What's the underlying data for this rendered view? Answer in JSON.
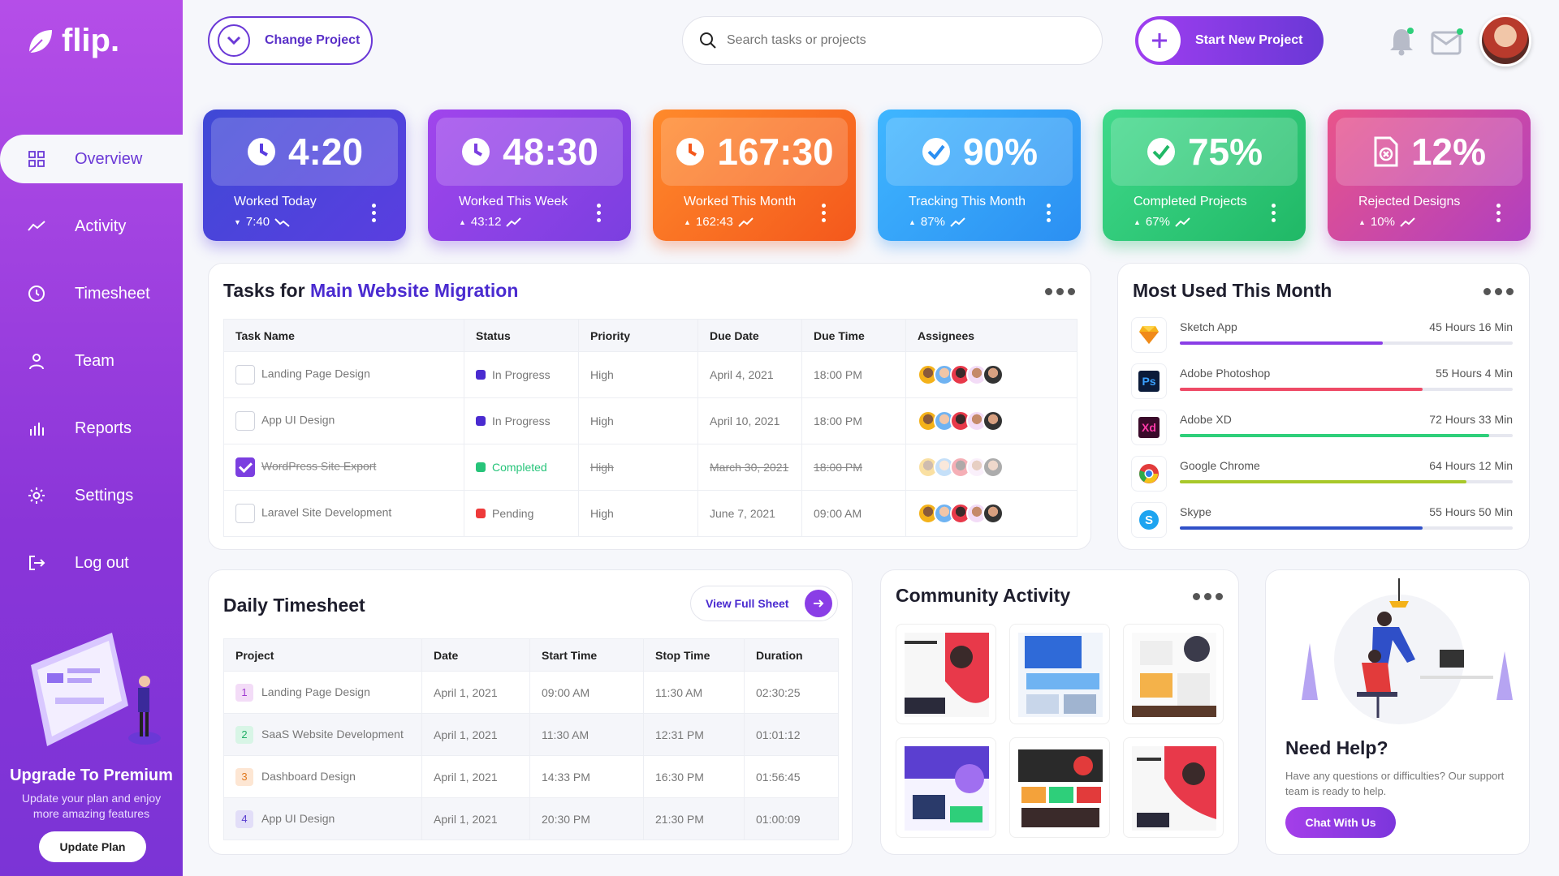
{
  "app": {
    "logo_text": "flip."
  },
  "sidebar": {
    "items": [
      {
        "label": "Overview",
        "icon": "grid-icon"
      },
      {
        "label": "Activity",
        "icon": "trend-icon"
      },
      {
        "label": "Timesheet",
        "icon": "clock-icon"
      },
      {
        "label": "Team",
        "icon": "user-icon"
      },
      {
        "label": "Reports",
        "icon": "bar-chart-icon"
      },
      {
        "label": "Settings",
        "icon": "gear-icon"
      },
      {
        "label": "Log out",
        "icon": "logout-icon"
      }
    ],
    "premium_title": "Upgrade To Premium",
    "premium_text": "Update your plan and enjoy more amazing features",
    "update_button": "Update Plan"
  },
  "header": {
    "change_project": "Change Project",
    "search_placeholder": "Search tasks or projects",
    "start_button": "Start New Project"
  },
  "stats": [
    {
      "value": "4:20",
      "label": "Worked Today",
      "sub": "7:40",
      "trend": "down",
      "color_from": "#3f49d6",
      "color_to": "#5a3ee0",
      "icon": "clock-icon"
    },
    {
      "value": "48:30",
      "label": "Worked This Week",
      "sub": "43:12",
      "trend": "up",
      "color_from": "#a045ec",
      "color_to": "#7b3fe0",
      "icon": "clock-icon"
    },
    {
      "value": "167:30",
      "label": "Worked This Month",
      "sub": "162:43",
      "trend": "up",
      "color_from": "#ff8a2b",
      "color_to": "#f4581c",
      "icon": "clock-icon"
    },
    {
      "value": "90%",
      "label": "Tracking This Month",
      "sub": "87%",
      "trend": "up",
      "color_from": "#3fb6ff",
      "color_to": "#2b8ff2",
      "icon": "check-icon"
    },
    {
      "value": "75%",
      "label": "Completed Projects",
      "sub": "67%",
      "trend": "up",
      "color_from": "#3fd98a",
      "color_to": "#20b866",
      "icon": "check-icon"
    },
    {
      "value": "12%",
      "label": "Rejected Designs",
      "sub": "10%",
      "trend": "up",
      "color_from": "#e9548a",
      "color_to": "#b03fc0",
      "icon": "file-x-icon"
    }
  ],
  "tasks": {
    "title_prefix": "Tasks for",
    "project_name": "Main Website Migration",
    "columns": [
      "Task Name",
      "Status",
      "Priority",
      "Due Date",
      "Due Time",
      "Assignees"
    ],
    "rows": [
      {
        "name": "Landing Page Design",
        "status": "In Progress",
        "status_color": "#4a2bd0",
        "priority": "High",
        "date": "April 4, 2021",
        "time": "18:00 PM",
        "done": false
      },
      {
        "name": "App UI Design",
        "status": "In Progress",
        "status_color": "#4a2bd0",
        "priority": "High",
        "date": "April 10, 2021",
        "time": "18:00 PM",
        "done": false
      },
      {
        "name": "WordPress Site Export",
        "status": "Completed",
        "status_color": "#27c47a",
        "priority": "High",
        "date": "March 30, 2021",
        "time": "18:00 PM",
        "done": true
      },
      {
        "name": "Laravel Site Development",
        "status": "Pending",
        "status_color": "#ee3a3a",
        "priority": "High",
        "date": "June 7, 2021",
        "time": "09:00 AM",
        "done": false
      }
    ]
  },
  "most_used": {
    "title": "Most Used This Month",
    "items": [
      {
        "name": "Sketch App",
        "hours": "45 Hours 16 Min",
        "fill": 0.61,
        "color": "#8a3ee6",
        "icon": "sketch-icon"
      },
      {
        "name": "Adobe Photoshop",
        "hours": "55 Hours 4 Min",
        "fill": 0.73,
        "color": "#ee4a66",
        "icon": "photoshop-icon",
        "icon_text": "Ps"
      },
      {
        "name": "Adobe XD",
        "hours": "72 Hours 33 Min",
        "fill": 0.93,
        "color": "#2ecf7a",
        "icon": "xd-icon",
        "icon_text": "Xd"
      },
      {
        "name": "Google Chrome",
        "hours": "64 Hours 12 Min",
        "fill": 0.86,
        "color": "#a8c82a",
        "icon": "chrome-icon"
      },
      {
        "name": "Skype",
        "hours": "55 Hours 50 Min",
        "fill": 0.73,
        "color": "#3050c8",
        "icon": "skype-icon"
      }
    ]
  },
  "timesheet": {
    "title": "Daily Timesheet",
    "view_button": "View Full Sheet",
    "columns": [
      "Project",
      "Date",
      "Start Time",
      "Stop Time",
      "Duration"
    ],
    "rows": [
      {
        "num": "1",
        "name": "Landing Page Design",
        "date": "April 1, 2021",
        "start": "09:00 AM",
        "stop": "11:30 AM",
        "duration": "02:30:25",
        "badge_bg": "#f3dcf7",
        "badge_fg": "#a03ad0"
      },
      {
        "num": "2",
        "name": "SaaS Website Development",
        "date": "April 1, 2021",
        "start": "11:30 AM",
        "stop": "12:31 PM",
        "duration": "01:01:12",
        "badge_bg": "#d8f5e6",
        "badge_fg": "#1fae66"
      },
      {
        "num": "3",
        "name": "Dashboard Design",
        "date": "April 1, 2021",
        "start": "14:33 PM",
        "stop": "16:30 PM",
        "duration": "01:56:45",
        "badge_bg": "#fde6d3",
        "badge_fg": "#e0781e"
      },
      {
        "num": "4",
        "name": "App UI Design",
        "date": "April 1, 2021",
        "start": "20:30 PM",
        "stop": "21:30 PM",
        "duration": "01:00:09",
        "badge_bg": "#e2def8",
        "badge_fg": "#5a3ed0"
      }
    ]
  },
  "community": {
    "title": "Community Activity"
  },
  "help": {
    "title": "Need Help?",
    "text": "Have any questions or difficulties? Our support team is ready to help.",
    "button": "Chat With Us"
  }
}
